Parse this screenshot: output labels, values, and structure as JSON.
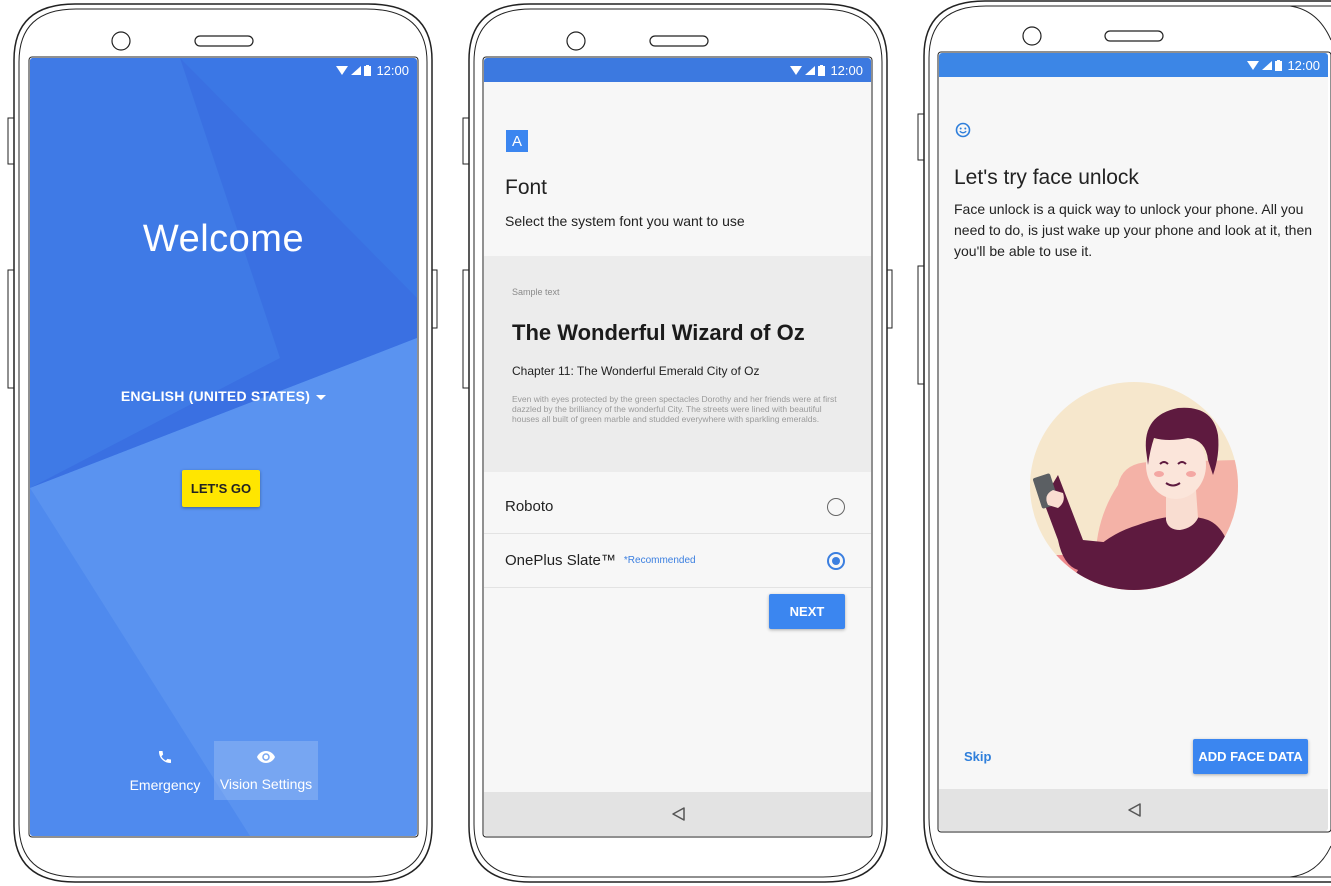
{
  "status_bar": {
    "time": "12:00"
  },
  "welcome_screen": {
    "title": "Welcome",
    "language": "ENGLISH (UNITED STATES)",
    "lets_go": "LET'S GO",
    "emergency": "Emergency",
    "vision_settings": "Vision Settings"
  },
  "font_screen": {
    "icon_letter": "A",
    "title": "Font",
    "subtitle": "Select the system font you want to use",
    "sample": {
      "label": "Sample text",
      "heading": "The Wonderful Wizard of Oz",
      "chapter": "Chapter 11: The Wonderful Emerald City of Oz",
      "body": "Even with eyes protected by the green spectacles Dorothy and her friends were at first dazzled by the brilliancy of the wonderful City. The streets were lined with beautiful houses all built of green marble and studded everywhere with sparkling emeralds."
    },
    "options": [
      {
        "label": "Roboto",
        "badge": "",
        "selected": false
      },
      {
        "label": "OnePlus Slate™",
        "badge": "*Recommended",
        "selected": true
      }
    ],
    "next": "NEXT"
  },
  "face_screen": {
    "title": "Let's try face unlock",
    "description": "Face unlock is a quick way to unlock your phone. All you need to do, is just wake up your phone and look at it, then you'll be able to use it.",
    "skip": "Skip",
    "add_face": "ADD FACE DATA"
  },
  "colors": {
    "welcome_blue": "#3b77e5",
    "accent_blue": "#3b86f0",
    "lets_go_yellow": "#ffe600"
  }
}
